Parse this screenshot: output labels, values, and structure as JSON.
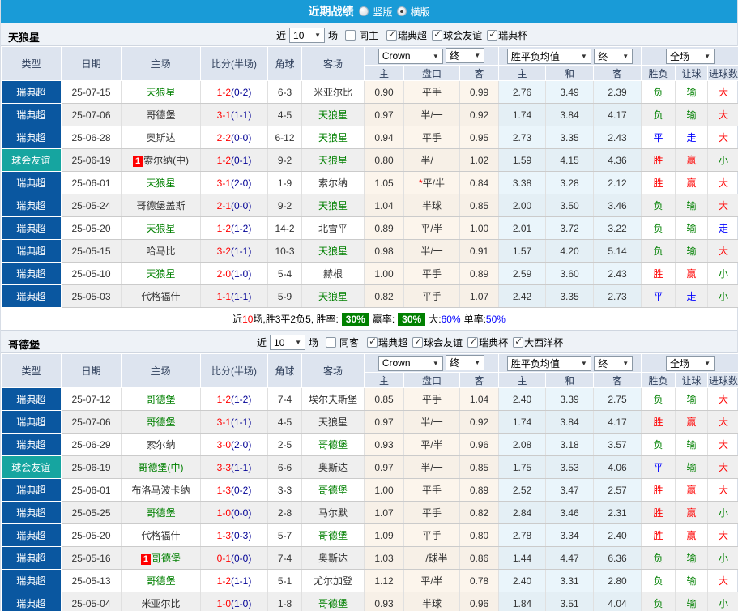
{
  "title_bar": {
    "title": "近期战绩",
    "radios": [
      {
        "label": "竖版",
        "selected": false
      },
      {
        "label": "横版",
        "selected": true
      }
    ]
  },
  "table_header": {
    "type": "类型",
    "date": "日期",
    "home": "主场",
    "score": "比分(半场)",
    "corner": "角球",
    "away": "客场",
    "odds_home": "主",
    "odds_line": "盘口",
    "odds_away": "客",
    "avg_home": "主",
    "avg_draw": "和",
    "avg_away": "客",
    "result": "胜负",
    "handicap": "让球",
    "goals": "进球数",
    "dd_bookmaker": "Crown",
    "dd_final1": "终",
    "dd_avg": "胜平负均值",
    "dd_final2": "终",
    "dd_scope": "全场"
  },
  "colors": {
    "accent_blue": "#199bd7",
    "league_blue": "#0a57a0",
    "friendly_teal": "#16a5a0",
    "win_red": "#ff0000",
    "lose_green": "#008000",
    "draw_blue": "#0000ff",
    "score_half_blue": "#000095",
    "badge_green": "#008000"
  },
  "sections": [
    {
      "team": "天狼星",
      "filter": {
        "near": "近",
        "count": "10",
        "games": "场",
        "same": "同主",
        "same_checked": false,
        "leagues": [
          {
            "label": "瑞典超",
            "checked": true
          },
          {
            "label": "球会友谊",
            "checked": true
          },
          {
            "label": "瑞典杯",
            "checked": true
          }
        ]
      },
      "rows": [
        {
          "type": "瑞典超",
          "type_class": "league",
          "date": "25-07-15",
          "home": "天狼星",
          "home_class": "g",
          "home_badge": "",
          "score_ft": "1-2",
          "score_ht": "(0-2)",
          "corner": "6-3",
          "away": "米亚尔比",
          "away_class": "",
          "away_badge": "",
          "odds_home": "0.90",
          "odds_line_star": "",
          "odds_line": "平手",
          "odds_away": "0.99",
          "avg_home": "2.76",
          "avg_draw": "3.49",
          "avg_away": "2.39",
          "result": "负",
          "result_class": "lose",
          "handicap_result": "输",
          "handicap_class": "lose",
          "goals": "大",
          "goals_class": "big"
        },
        {
          "type": "瑞典超",
          "type_class": "league",
          "date": "25-07-06",
          "home": "哥德堡",
          "home_class": "",
          "home_badge": "",
          "score_ft": "3-1",
          "score_ht": "(1-1)",
          "corner": "4-5",
          "away": "天狼星",
          "away_class": "g",
          "away_badge": "",
          "odds_home": "0.97",
          "odds_line_star": "",
          "odds_line": "半/一",
          "odds_away": "0.92",
          "avg_home": "1.74",
          "avg_draw": "3.84",
          "avg_away": "4.17",
          "result": "负",
          "result_class": "lose",
          "handicap_result": "输",
          "handicap_class": "lose",
          "goals": "大",
          "goals_class": "big"
        },
        {
          "type": "瑞典超",
          "type_class": "league",
          "date": "25-06-28",
          "home": "奥斯达",
          "home_class": "",
          "home_badge": "",
          "score_ft": "2-2",
          "score_ht": "(0-0)",
          "corner": "6-12",
          "away": "天狼星",
          "away_class": "g",
          "away_badge": "",
          "odds_home": "0.94",
          "odds_line_star": "",
          "odds_line": "平手",
          "odds_away": "0.95",
          "avg_home": "2.73",
          "avg_draw": "3.35",
          "avg_away": "2.43",
          "result": "平",
          "result_class": "draw",
          "handicap_result": "走",
          "handicap_class": "draw",
          "goals": "大",
          "goals_class": "big"
        },
        {
          "type": "球会友谊",
          "type_class": "friendly",
          "date": "25-06-19",
          "home": "索尔纳(中)",
          "home_class": "",
          "home_badge": "1",
          "score_ft": "1-2",
          "score_ht": "(0-1)",
          "corner": "9-2",
          "away": "天狼星",
          "away_class": "g",
          "away_badge": "",
          "odds_home": "0.80",
          "odds_line_star": "",
          "odds_line": "半/一",
          "odds_away": "1.02",
          "avg_home": "1.59",
          "avg_draw": "4.15",
          "avg_away": "4.36",
          "result": "胜",
          "result_class": "win",
          "handicap_result": "赢",
          "handicap_class": "win",
          "goals": "小",
          "goals_class": "small"
        },
        {
          "type": "瑞典超",
          "type_class": "league",
          "date": "25-06-01",
          "home": "天狼星",
          "home_class": "g",
          "home_badge": "",
          "score_ft": "3-1",
          "score_ht": "(2-0)",
          "corner": "1-9",
          "away": "索尔纳",
          "away_class": "",
          "away_badge": "",
          "odds_home": "1.05",
          "odds_line_star": "*",
          "odds_line": "平/半",
          "odds_away": "0.84",
          "avg_home": "3.38",
          "avg_draw": "3.28",
          "avg_away": "2.12",
          "result": "胜",
          "result_class": "win",
          "handicap_result": "赢",
          "handicap_class": "win",
          "goals": "大",
          "goals_class": "big"
        },
        {
          "type": "瑞典超",
          "type_class": "league",
          "date": "25-05-24",
          "home": "哥德堡盖斯",
          "home_class": "",
          "home_badge": "",
          "score_ft": "2-1",
          "score_ht": "(0-0)",
          "corner": "9-2",
          "away": "天狼星",
          "away_class": "g",
          "away_badge": "",
          "odds_home": "1.04",
          "odds_line_star": "",
          "odds_line": "半球",
          "odds_away": "0.85",
          "avg_home": "2.00",
          "avg_draw": "3.50",
          "avg_away": "3.46",
          "result": "负",
          "result_class": "lose",
          "handicap_result": "输",
          "handicap_class": "lose",
          "goals": "大",
          "goals_class": "big"
        },
        {
          "type": "瑞典超",
          "type_class": "league",
          "date": "25-05-20",
          "home": "天狼星",
          "home_class": "g",
          "home_badge": "",
          "score_ft": "1-2",
          "score_ht": "(1-2)",
          "corner": "14-2",
          "away": "北雪平",
          "away_class": "",
          "away_badge": "",
          "odds_home": "0.89",
          "odds_line_star": "",
          "odds_line": "平/半",
          "odds_away": "1.00",
          "avg_home": "2.01",
          "avg_draw": "3.72",
          "avg_away": "3.22",
          "result": "负",
          "result_class": "lose",
          "handicap_result": "输",
          "handicap_class": "lose",
          "goals": "走",
          "goals_class": "go"
        },
        {
          "type": "瑞典超",
          "type_class": "league",
          "date": "25-05-15",
          "home": "哈马比",
          "home_class": "",
          "home_badge": "",
          "score_ft": "3-2",
          "score_ht": "(1-1)",
          "corner": "10-3",
          "away": "天狼星",
          "away_class": "g",
          "away_badge": "",
          "odds_home": "0.98",
          "odds_line_star": "",
          "odds_line": "半/一",
          "odds_away": "0.91",
          "avg_home": "1.57",
          "avg_draw": "4.20",
          "avg_away": "5.14",
          "result": "负",
          "result_class": "lose",
          "handicap_result": "输",
          "handicap_class": "lose",
          "goals": "大",
          "goals_class": "big"
        },
        {
          "type": "瑞典超",
          "type_class": "league",
          "date": "25-05-10",
          "home": "天狼星",
          "home_class": "g",
          "home_badge": "",
          "score_ft": "2-0",
          "score_ht": "(1-0)",
          "corner": "5-4",
          "away": "赫根",
          "away_class": "",
          "away_badge": "",
          "odds_home": "1.00",
          "odds_line_star": "",
          "odds_line": "平手",
          "odds_away": "0.89",
          "avg_home": "2.59",
          "avg_draw": "3.60",
          "avg_away": "2.43",
          "result": "胜",
          "result_class": "win",
          "handicap_result": "赢",
          "handicap_class": "win",
          "goals": "小",
          "goals_class": "small"
        },
        {
          "type": "瑞典超",
          "type_class": "league",
          "date": "25-05-03",
          "home": "代格福什",
          "home_class": "",
          "home_badge": "",
          "score_ft": "1-1",
          "score_ht": "(1-1)",
          "corner": "5-9",
          "away": "天狼星",
          "away_class": "g",
          "away_badge": "",
          "odds_home": "0.82",
          "odds_line_star": "",
          "odds_line": "平手",
          "odds_away": "1.07",
          "avg_home": "2.42",
          "avg_draw": "3.35",
          "avg_away": "2.73",
          "result": "平",
          "result_class": "draw",
          "handicap_result": "走",
          "handicap_class": "draw",
          "goals": "小",
          "goals_class": "small"
        }
      ],
      "summary": {
        "pre": "近",
        "count": "10",
        "mid": "场,胜3平2负5, 胜率:",
        "win_rate": "30%",
        "mid2": "赢率:",
        "handicap_rate": "30%",
        "big_label": "大:",
        "big_rate": "60%",
        "single_label": "单率:",
        "single_rate": "50%"
      }
    },
    {
      "team": "哥德堡",
      "filter": {
        "near": "近",
        "count": "10",
        "games": "场",
        "same": "同客",
        "same_checked": false,
        "leagues": [
          {
            "label": "瑞典超",
            "checked": true
          },
          {
            "label": "球会友谊",
            "checked": true
          },
          {
            "label": "瑞典杯",
            "checked": true
          },
          {
            "label": "大西洋杯",
            "checked": true
          }
        ]
      },
      "rows": [
        {
          "type": "瑞典超",
          "type_class": "league",
          "date": "25-07-12",
          "home": "哥德堡",
          "home_class": "g",
          "home_badge": "",
          "score_ft": "1-2",
          "score_ht": "(1-2)",
          "corner": "7-4",
          "away": "埃尔夫斯堡",
          "away_class": "",
          "away_badge": "",
          "odds_home": "0.85",
          "odds_line_star": "",
          "odds_line": "平手",
          "odds_away": "1.04",
          "avg_home": "2.40",
          "avg_draw": "3.39",
          "avg_away": "2.75",
          "result": "负",
          "result_class": "lose",
          "handicap_result": "输",
          "handicap_class": "lose",
          "goals": "大",
          "goals_class": "big"
        },
        {
          "type": "瑞典超",
          "type_class": "league",
          "date": "25-07-06",
          "home": "哥德堡",
          "home_class": "g",
          "home_badge": "",
          "score_ft": "3-1",
          "score_ht": "(1-1)",
          "corner": "4-5",
          "away": "天狼星",
          "away_class": "",
          "away_badge": "",
          "odds_home": "0.97",
          "odds_line_star": "",
          "odds_line": "半/一",
          "odds_away": "0.92",
          "avg_home": "1.74",
          "avg_draw": "3.84",
          "avg_away": "4.17",
          "result": "胜",
          "result_class": "win",
          "handicap_result": "赢",
          "handicap_class": "win",
          "goals": "大",
          "goals_class": "big"
        },
        {
          "type": "瑞典超",
          "type_class": "league",
          "date": "25-06-29",
          "home": "索尔纳",
          "home_class": "",
          "home_badge": "",
          "score_ft": "3-0",
          "score_ht": "(2-0)",
          "corner": "2-5",
          "away": "哥德堡",
          "away_class": "g",
          "away_badge": "",
          "odds_home": "0.93",
          "odds_line_star": "",
          "odds_line": "平/半",
          "odds_away": "0.96",
          "avg_home": "2.08",
          "avg_draw": "3.18",
          "avg_away": "3.57",
          "result": "负",
          "result_class": "lose",
          "handicap_result": "输",
          "handicap_class": "lose",
          "goals": "大",
          "goals_class": "big"
        },
        {
          "type": "球会友谊",
          "type_class": "friendly",
          "date": "25-06-19",
          "home": "哥德堡(中)",
          "home_class": "g",
          "home_badge": "",
          "score_ft": "3-3",
          "score_ht": "(1-1)",
          "corner": "6-6",
          "away": "奥斯达",
          "away_class": "",
          "away_badge": "",
          "odds_home": "0.97",
          "odds_line_star": "",
          "odds_line": "半/一",
          "odds_away": "0.85",
          "avg_home": "1.75",
          "avg_draw": "3.53",
          "avg_away": "4.06",
          "result": "平",
          "result_class": "draw",
          "handicap_result": "输",
          "handicap_class": "lose",
          "goals": "大",
          "goals_class": "big"
        },
        {
          "type": "瑞典超",
          "type_class": "league",
          "date": "25-06-01",
          "home": "布洛马波卡纳",
          "home_class": "",
          "home_badge": "",
          "score_ft": "1-3",
          "score_ht": "(0-2)",
          "corner": "3-3",
          "away": "哥德堡",
          "away_class": "g",
          "away_badge": "",
          "odds_home": "1.00",
          "odds_line_star": "",
          "odds_line": "平手",
          "odds_away": "0.89",
          "avg_home": "2.52",
          "avg_draw": "3.47",
          "avg_away": "2.57",
          "result": "胜",
          "result_class": "win",
          "handicap_result": "赢",
          "handicap_class": "win",
          "goals": "大",
          "goals_class": "big"
        },
        {
          "type": "瑞典超",
          "type_class": "league",
          "date": "25-05-25",
          "home": "哥德堡",
          "home_class": "g",
          "home_badge": "",
          "score_ft": "1-0",
          "score_ht": "(0-0)",
          "corner": "2-8",
          "away": "马尔默",
          "away_class": "",
          "away_badge": "",
          "odds_home": "1.07",
          "odds_line_star": "",
          "odds_line": "平手",
          "odds_away": "0.82",
          "avg_home": "2.84",
          "avg_draw": "3.46",
          "avg_away": "2.31",
          "result": "胜",
          "result_class": "win",
          "handicap_result": "赢",
          "handicap_class": "win",
          "goals": "小",
          "goals_class": "small"
        },
        {
          "type": "瑞典超",
          "type_class": "league",
          "date": "25-05-20",
          "home": "代格福什",
          "home_class": "",
          "home_badge": "",
          "score_ft": "1-3",
          "score_ht": "(0-3)",
          "corner": "5-7",
          "away": "哥德堡",
          "away_class": "g",
          "away_badge": "",
          "odds_home": "1.09",
          "odds_line_star": "",
          "odds_line": "平手",
          "odds_away": "0.80",
          "avg_home": "2.78",
          "avg_draw": "3.34",
          "avg_away": "2.40",
          "result": "胜",
          "result_class": "win",
          "handicap_result": "赢",
          "handicap_class": "win",
          "goals": "大",
          "goals_class": "big"
        },
        {
          "type": "瑞典超",
          "type_class": "league",
          "date": "25-05-16",
          "home": "哥德堡",
          "home_class": "g",
          "home_badge": "1",
          "score_ft": "0-1",
          "score_ht": "(0-0)",
          "corner": "7-4",
          "away": "奥斯达",
          "away_class": "",
          "away_badge": "",
          "odds_home": "1.03",
          "odds_line_star": "",
          "odds_line": "一/球半",
          "odds_away": "0.86",
          "avg_home": "1.44",
          "avg_draw": "4.47",
          "avg_away": "6.36",
          "result": "负",
          "result_class": "lose",
          "handicap_result": "输",
          "handicap_class": "lose",
          "goals": "小",
          "goals_class": "small"
        },
        {
          "type": "瑞典超",
          "type_class": "league",
          "date": "25-05-13",
          "home": "哥德堡",
          "home_class": "g",
          "home_badge": "",
          "score_ft": "1-2",
          "score_ht": "(1-1)",
          "corner": "5-1",
          "away": "尤尔加登",
          "away_class": "",
          "away_badge": "",
          "odds_home": "1.12",
          "odds_line_star": "",
          "odds_line": "平/半",
          "odds_away": "0.78",
          "avg_home": "2.40",
          "avg_draw": "3.31",
          "avg_away": "2.80",
          "result": "负",
          "result_class": "lose",
          "handicap_result": "输",
          "handicap_class": "lose",
          "goals": "大",
          "goals_class": "big"
        },
        {
          "type": "瑞典超",
          "type_class": "league",
          "date": "25-05-04",
          "home": "米亚尔比",
          "home_class": "",
          "home_badge": "",
          "score_ft": "1-0",
          "score_ht": "(1-0)",
          "corner": "1-8",
          "away": "哥德堡",
          "away_class": "g",
          "away_badge": "",
          "odds_home": "0.93",
          "odds_line_star": "",
          "odds_line": "半球",
          "odds_away": "0.96",
          "avg_home": "1.84",
          "avg_draw": "3.51",
          "avg_away": "4.04",
          "result": "负",
          "result_class": "lose",
          "handicap_result": "输",
          "handicap_class": "lose",
          "goals": "小",
          "goals_class": "small"
        }
      ]
    }
  ]
}
